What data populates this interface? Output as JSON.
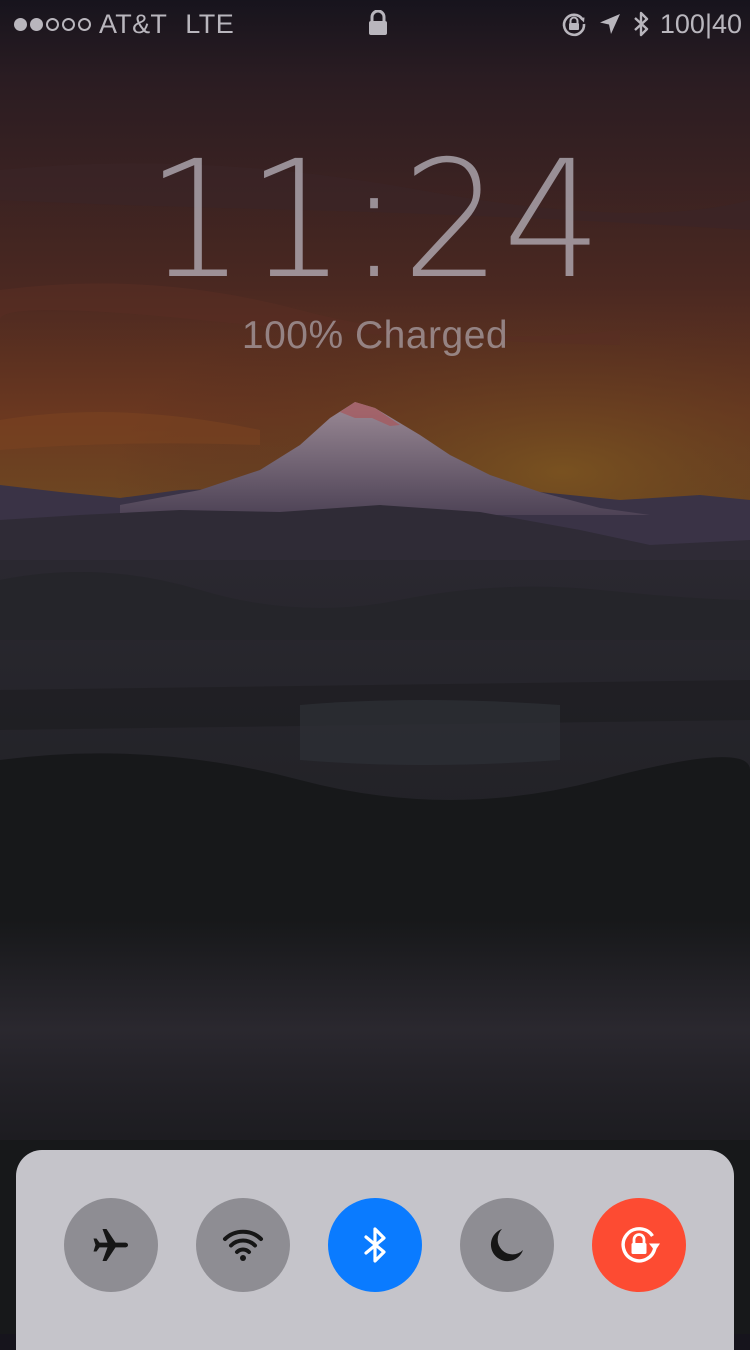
{
  "status_bar": {
    "signal_bars_filled": 2,
    "signal_bars_total": 5,
    "carrier": "AT&T",
    "network": "LTE",
    "center_icon": "lock-icon",
    "right_icons": [
      "rotation-lock-icon",
      "location-arrow-icon",
      "bluetooth-icon"
    ],
    "battery_text": "100|40"
  },
  "lock_screen": {
    "time": "11:24",
    "charge_status": "100% Charged"
  },
  "control_center": {
    "toggles": [
      {
        "name": "airplane-mode",
        "icon": "airplane-icon",
        "active": false,
        "color": "#8e8d93"
      },
      {
        "name": "wifi",
        "icon": "wifi-icon",
        "active": false,
        "color": "#8e8d93"
      },
      {
        "name": "bluetooth",
        "icon": "bluetooth-icon",
        "active": true,
        "color": "#0a7bff"
      },
      {
        "name": "do-not-disturb",
        "icon": "moon-icon",
        "active": false,
        "color": "#8e8d93"
      },
      {
        "name": "rotation-lock",
        "icon": "rotation-lock-icon",
        "active": true,
        "color": "#fd4b32"
      }
    ]
  },
  "colors": {
    "status_text": "#b9b6bd",
    "panel_background": "#c5c4ca",
    "inactive_toggle": "#8e8d93",
    "bluetooth_active": "#0a7bff",
    "rotation_lock_active": "#fd4b32"
  }
}
